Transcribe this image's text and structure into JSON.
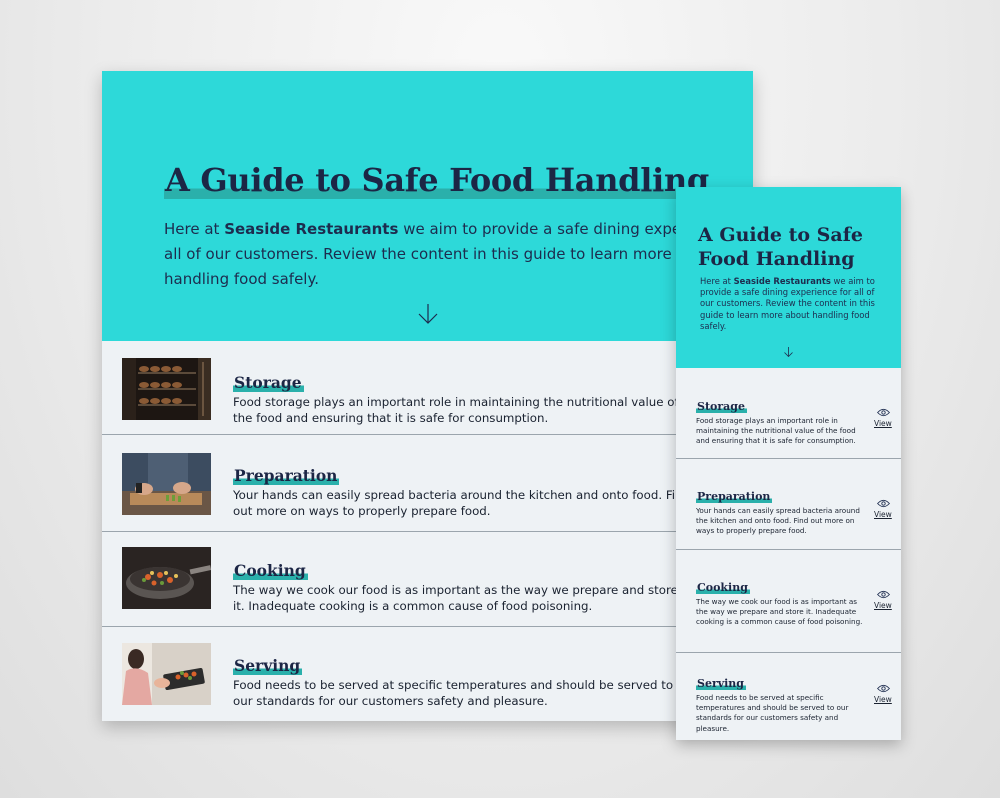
{
  "desktop": {
    "title": "A Guide to Safe Food Handling",
    "intro": {
      "before": "Here at ",
      "brand": "Seaside Restaurants",
      "after": " we aim to provide a safe dining experience for all of our customers. Review the content in this guide to learn more about handling food safely."
    },
    "sections": [
      {
        "title": "Storage",
        "text": "Food storage plays an important role in maintaining the nutritional value of the food and ensuring that it is safe for consumption."
      },
      {
        "title": "Preparation",
        "text": "Your hands can easily spread bacteria around the kitchen and onto food. Find out more on ways to properly prepare food."
      },
      {
        "title": "Cooking",
        "text": "The way we cook our food is as important as the way we prepare and store it. Inadequate cooking is a common cause of food poisoning."
      },
      {
        "title": "Serving",
        "text": "Food needs to be served at specific temperatures and should be served to our standards for our customers safety and pleasure."
      }
    ]
  },
  "mobile": {
    "title": "A Guide to Safe Food Handling",
    "intro": {
      "before": "Here at ",
      "brand": "Seaside Restaurants",
      "after": " we aim to provide a safe dining experience for all of our customers. Review the content in this guide to learn more about handling food safely."
    },
    "view_label": "View",
    "sections": [
      {
        "title": "Storage",
        "text": "Food storage plays an important role in maintaining the nutritional value of the food and ensuring that it is safe for consumption."
      },
      {
        "title": "Preparation",
        "text": "Your hands can easily spread bacteria around the kitchen and onto food.  Find out more on ways to properly prepare food."
      },
      {
        "title": "Cooking",
        "text": "The way we cook our food is as important as the way we prepare and store it. Inadequate cooking is a common cause of food poisoning."
      },
      {
        "title": "Serving",
        "text": "Food needs to be served at specific temperatures and should be served to our standards for our customers safety and pleasure."
      }
    ]
  },
  "icons": {
    "scroll_down": "arrow-down-icon",
    "view": "eye-icon"
  },
  "colors": {
    "hero_background": "#2dd9d9",
    "title_color": "#1c2645",
    "underline_accent": "#2ab0ab",
    "page_background": "#eef2f5",
    "divider": "#9ba5ad"
  }
}
